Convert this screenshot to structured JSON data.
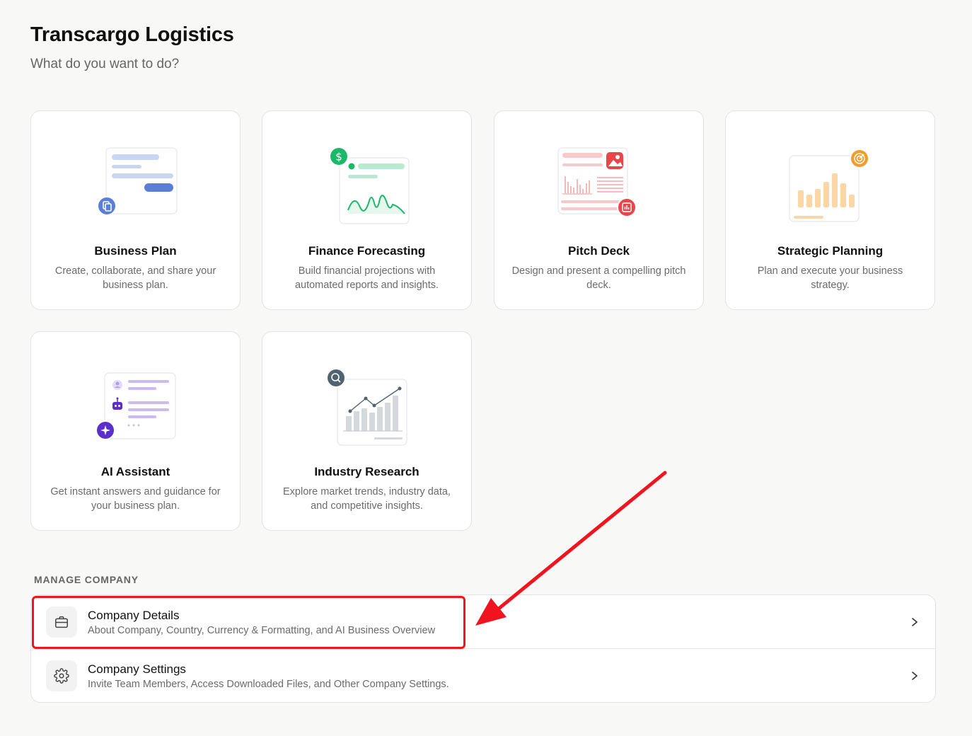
{
  "header": {
    "title": "Transcargo Logistics",
    "subtitle": "What do you want to do?"
  },
  "cards": [
    {
      "title": "Business Plan",
      "description": "Create, collaborate, and share your business plan.",
      "icon": "document-icon",
      "accent": "#5b7ed9"
    },
    {
      "title": "Finance Forecasting",
      "description": "Build financial projections with automated reports and insights.",
      "icon": "dollar-icon",
      "accent": "#1cb86a"
    },
    {
      "title": "Pitch Deck",
      "description": "Design and present a compelling pitch deck.",
      "icon": "presentation-chart-icon",
      "accent": "#e8474a"
    },
    {
      "title": "Strategic Planning",
      "description": "Plan and execute your business strategy.",
      "icon": "target-icon",
      "accent": "#f59b2a"
    },
    {
      "title": "AI Assistant",
      "description": "Get instant answers and guidance for your business plan.",
      "icon": "sparkle-icon",
      "accent": "#5b2fc9"
    },
    {
      "title": "Industry Research",
      "description": "Explore market trends, industry data, and competitive insights.",
      "icon": "search-chart-icon",
      "accent": "#4f6370"
    }
  ],
  "manage": {
    "section_label": "MANAGE COMPANY",
    "items": [
      {
        "title": "Company Details",
        "description": "About Company, Country, Currency & Formatting, and AI Business Overview",
        "icon": "briefcase-icon"
      },
      {
        "title": "Company Settings",
        "description": "Invite Team Members, Access Downloaded Files, and Other Company Settings.",
        "icon": "gear-icon"
      }
    ]
  },
  "annotation": {
    "highlight_color": "#f0141e"
  }
}
